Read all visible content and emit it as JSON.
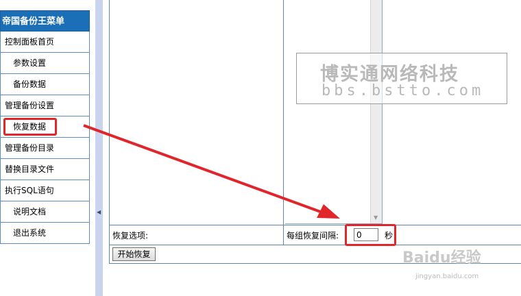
{
  "menu": {
    "title": "帝国备份王菜单",
    "items": [
      {
        "label": "控制面板首页",
        "level": 1
      },
      {
        "label": "参数设置",
        "level": 2
      },
      {
        "label": "备份数据",
        "level": 2
      },
      {
        "label": "管理备份设置",
        "level": 1
      },
      {
        "label": "恢复数据",
        "level": 2
      },
      {
        "label": "管理备份目录",
        "level": 1
      },
      {
        "label": "替换目录文件",
        "level": 1
      },
      {
        "label": "执行SQL语句",
        "level": 1
      },
      {
        "label": "说明文档",
        "level": 2
      },
      {
        "label": "退出系统",
        "level": 2
      }
    ]
  },
  "form": {
    "restore_options_label": "恢复选项:",
    "interval_label": "每组恢复间隔:",
    "interval_value": "0",
    "interval_unit": "秒",
    "start_button": "开始恢复"
  },
  "watermark": {
    "title": "博实通网络科技",
    "url": "bbs.bstto.com"
  },
  "baidu_watermark": {
    "logo": "Baidu经验",
    "url": "jingyan.baidu.com"
  },
  "colors": {
    "menu_header": "#1b6fb7",
    "annotation_red": "#e0262b",
    "splitter": "#c9d5ef"
  }
}
